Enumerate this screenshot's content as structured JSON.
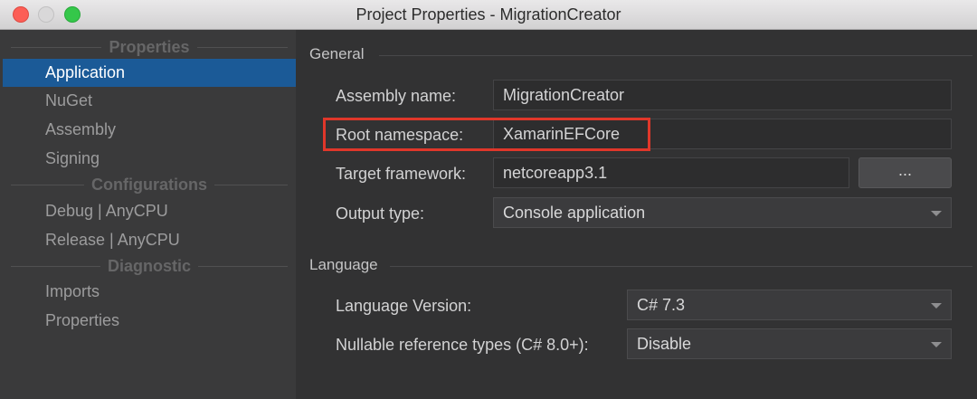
{
  "window": {
    "title": "Project Properties - MigrationCreator",
    "colors": {
      "selection": "#1b5a97",
      "highlight": "#e0372a"
    }
  },
  "sidebar": {
    "sections": [
      {
        "title": "Properties",
        "items": [
          "Application",
          "NuGet",
          "Assembly",
          "Signing"
        ]
      },
      {
        "title": "Configurations",
        "items": [
          "Debug | AnyCPU",
          "Release | AnyCPU"
        ]
      },
      {
        "title": "Diagnostic",
        "items": [
          "Imports",
          "Properties"
        ]
      }
    ],
    "selected": "Application"
  },
  "general": {
    "title": "General",
    "assembly_name_label": "Assembly name:",
    "assembly_name_value": "MigrationCreator",
    "root_namespace_label": "Root namespace:",
    "root_namespace_value": "XamarinEFCore",
    "target_framework_label": "Target framework:",
    "target_framework_value": "netcoreapp3.1",
    "browse_label": "...",
    "output_type_label": "Output type:",
    "output_type_value": "Console application"
  },
  "language": {
    "title": "Language",
    "version_label": "Language Version:",
    "version_value": "C# 7.3",
    "nullable_label": "Nullable reference types (C# 8.0+):",
    "nullable_value": "Disable"
  }
}
